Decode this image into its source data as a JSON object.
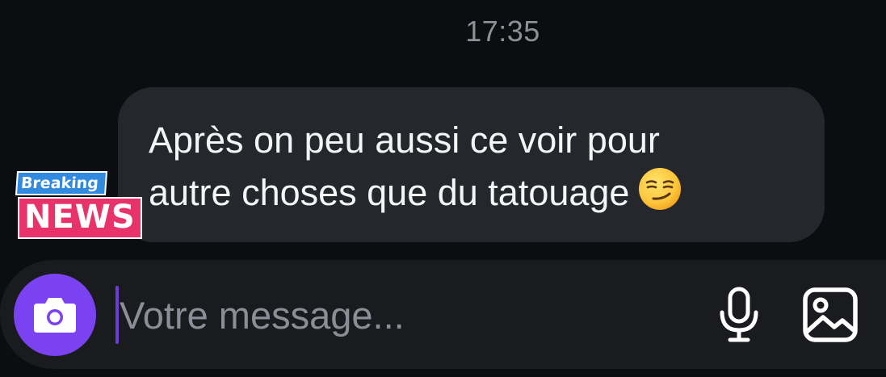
{
  "conversation": {
    "timestamp": "17:35"
  },
  "message": {
    "line1": "Après on peu aussi ce voir pour",
    "line2": "autre choses que du tatouage",
    "emoji": "smirking-face-emoji"
  },
  "avatar": {
    "badge_top": "Breaking",
    "badge_bottom": "NEWS"
  },
  "composer": {
    "placeholder": "Votre message...",
    "camera_icon": "camera-icon",
    "mic_icon": "microphone-icon",
    "image_icon": "image-icon",
    "accent_color": "#7a42f0"
  }
}
